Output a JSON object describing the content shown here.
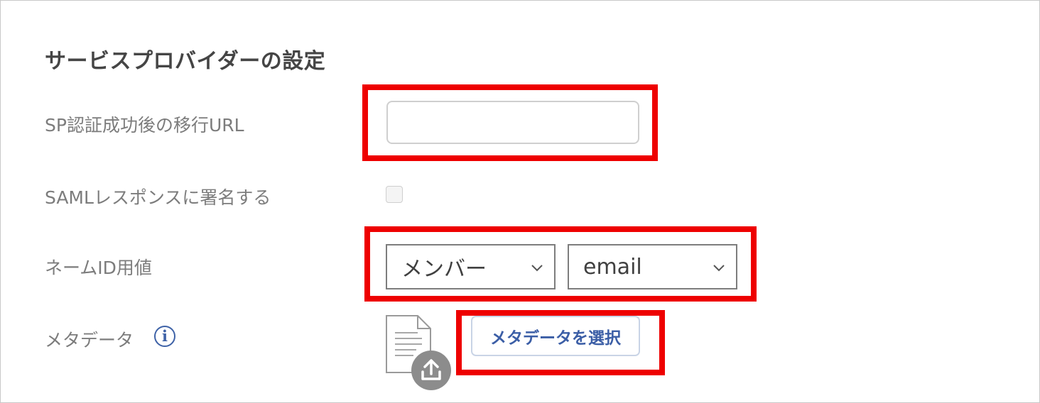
{
  "section": {
    "title": "サービスプロバイダーの設定"
  },
  "fields": {
    "redirect_url": {
      "label": "SP認証成功後の移行URL",
      "value": ""
    },
    "sign_response": {
      "label": "SAMLレスポンスに署名する",
      "checked": false
    },
    "name_id": {
      "label": "ネームID用値",
      "source": {
        "selected": "メンバー"
      },
      "attribute": {
        "selected": "email"
      }
    },
    "metadata": {
      "label": "メタデータ",
      "info_glyph": "i",
      "select_button_label": "メタデータを選択"
    }
  },
  "colors": {
    "highlight": "#ee0000",
    "accent": "#3b5ea6",
    "label": "#7c7c7c",
    "title": "#454545"
  },
  "icons": [
    "info-icon",
    "document-icon",
    "upload-icon",
    "chevron-down-icon"
  ]
}
